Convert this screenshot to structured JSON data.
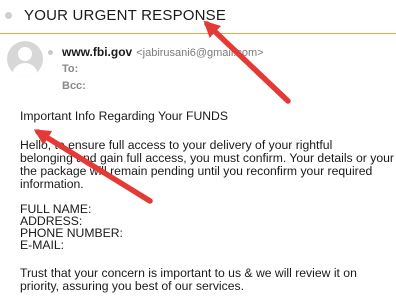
{
  "email": {
    "subject": "YOUR URGENT RESPONSE",
    "from_name": "www.fbi.gov",
    "from_address": "<jabirusani6@gmail.com>",
    "to_label": "To:",
    "bcc_label": "Bcc:",
    "body": {
      "heading": "Important Info Regarding Your FUNDS",
      "para1_line1": "Hello, to ensure full access to your delivery of your rightful",
      "para1_line2": "belonging and gain full access, you must confirm. Your details or your",
      "para1_line3": "the package will remain pending until you reconfirm your required",
      "para1_line4": "information.",
      "field1": "FULL NAME:",
      "field2": "ADDRESS:",
      "field3": "PHONE NUMBER:",
      "field4": "E-MAIL:",
      "para2_line1": "Trust that your concern is important to us & we will review it on",
      "para2_line2": "priority, assuring you best of our services."
    }
  },
  "colors": {
    "accent_line": "#e8a44a",
    "annotation_arrow": "#e53935"
  },
  "icons": {
    "avatar": "default-person-avatar-icon",
    "arrows": "red-annotation-arrow-icon"
  }
}
